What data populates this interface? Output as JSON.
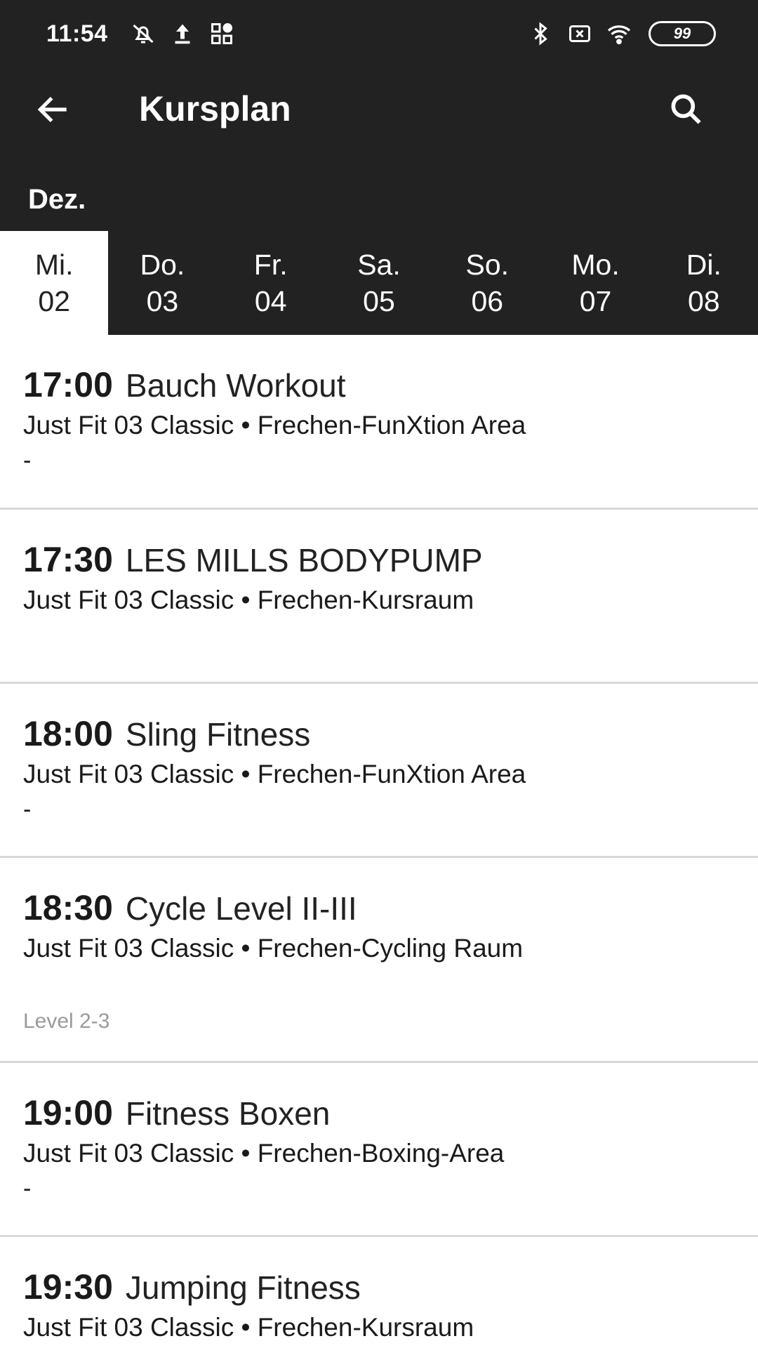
{
  "status_bar": {
    "time": "11:54",
    "left_icons": [
      "muted-bell-icon",
      "upload-icon",
      "app-grid-icon"
    ],
    "right_icons": [
      "bluetooth-icon",
      "no-sim-icon",
      "wifi-icon"
    ],
    "battery": "99"
  },
  "app_bar": {
    "title": "Kursplan",
    "back_icon": "arrow-back-icon",
    "search_icon": "search-icon"
  },
  "month": "Dez.",
  "days": [
    {
      "weekday": "Mi.",
      "date": "02",
      "selected": true
    },
    {
      "weekday": "Do.",
      "date": "03",
      "selected": false
    },
    {
      "weekday": "Fr.",
      "date": "04",
      "selected": false
    },
    {
      "weekday": "Sa.",
      "date": "05",
      "selected": false
    },
    {
      "weekday": "So.",
      "date": "06",
      "selected": false
    },
    {
      "weekday": "Mo.",
      "date": "07",
      "selected": false
    },
    {
      "weekday": "Di.",
      "date": "08",
      "selected": false
    }
  ],
  "courses": [
    {
      "time": "17:00",
      "name": "Bauch Workout",
      "location": "Just Fit 03 Classic • Frechen-FunXtion Area",
      "extra": "-",
      "note": ""
    },
    {
      "time": "17:30",
      "name": "LES MILLS BODYPUMP",
      "location": "Just Fit 03 Classic • Frechen-Kursraum",
      "extra": "",
      "note": ""
    },
    {
      "time": "18:00",
      "name": "Sling Fitness",
      "location": "Just Fit 03 Classic • Frechen-FunXtion Area",
      "extra": "-",
      "note": ""
    },
    {
      "time": "18:30",
      "name": "Cycle Level II-III",
      "location": "Just Fit 03 Classic • Frechen-Cycling Raum",
      "extra": "",
      "note": "Level 2-3"
    },
    {
      "time": "19:00",
      "name": "Fitness Boxen",
      "location": "Just Fit 03 Classic • Frechen-Boxing-Area",
      "extra": "-",
      "note": ""
    },
    {
      "time": "19:30",
      "name": "Jumping Fitness",
      "location": "Just Fit 03 Classic • Frechen-Kursraum",
      "extra": "",
      "note": ""
    }
  ],
  "colors": {
    "header_bg": "#222222",
    "selected_tab_bg": "#ffffff",
    "divider": "#d8d8d8",
    "note_text": "#9a9a9a"
  }
}
